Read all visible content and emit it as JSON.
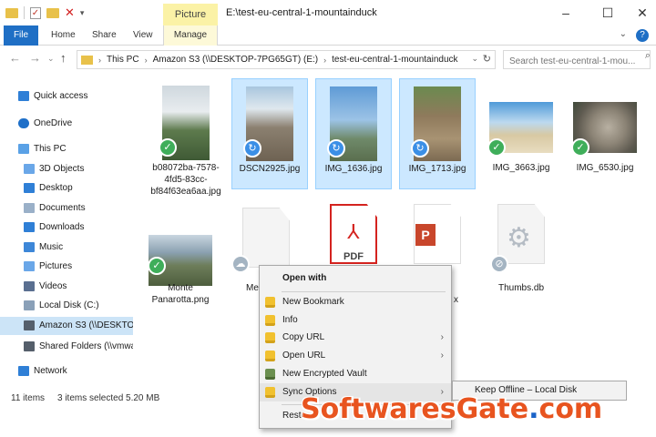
{
  "window": {
    "title": "E:\\test-eu-central-1-mountainduck",
    "context_tab_title": "Picture Tools",
    "controls": [
      "–",
      "☐",
      "✕"
    ]
  },
  "ribbon": {
    "tabs": [
      "File",
      "Home",
      "Share",
      "View"
    ],
    "context_tab": "Manage"
  },
  "address": {
    "crumbs": [
      "This PC",
      "Amazon S3 (\\\\DESKTOP-7PG65GT) (E:)",
      "test-eu-central-1-mountainduck"
    ],
    "search_placeholder": "Search test-eu-central-1-mou..."
  },
  "nav": {
    "items": [
      {
        "label": "Quick access",
        "icon": "star-icon",
        "color": "#2f7fd6"
      },
      {
        "label": "OneDrive",
        "icon": "cloud-icon",
        "color": "#1e6fc8"
      },
      {
        "label": "This PC",
        "icon": "computer-icon",
        "color": "#5aa1e6"
      },
      {
        "label": "3D Objects",
        "icon": "cube-icon",
        "color": "#6aa7e8"
      },
      {
        "label": "Desktop",
        "icon": "desktop-icon",
        "color": "#2f7fd6"
      },
      {
        "label": "Documents",
        "icon": "documents-icon",
        "color": "#9ab0c8"
      },
      {
        "label": "Downloads",
        "icon": "download-icon",
        "color": "#2f7fd6"
      },
      {
        "label": "Music",
        "icon": "music-icon",
        "color": "#3d87d8"
      },
      {
        "label": "Pictures",
        "icon": "pictures-icon",
        "color": "#6aa7e8"
      },
      {
        "label": "Videos",
        "icon": "videos-icon",
        "color": "#5a6f90"
      },
      {
        "label": "Local Disk (C:)",
        "icon": "drive-icon",
        "color": "#8aa0b8"
      },
      {
        "label": "Amazon S3 (\\\\DESKTOP-7",
        "icon": "network-drive-icon",
        "color": "#555f6b"
      },
      {
        "label": "Shared Folders (\\\\vmware",
        "icon": "network-drive-icon",
        "color": "#555f6b"
      },
      {
        "label": "Network",
        "icon": "network-icon",
        "color": "#2f7fd6"
      }
    ]
  },
  "files": [
    {
      "label": "b08072ba-7578-4fd5-83cc-bf84f63ea6aa.jpg",
      "badge": "ok",
      "selected": false
    },
    {
      "label": "DSCN2925.jpg",
      "badge": "sync",
      "selected": true
    },
    {
      "label": "IMG_1636.jpg",
      "badge": "sync",
      "selected": true
    },
    {
      "label": "IMG_1713.jpg",
      "badge": "sync",
      "selected": true
    },
    {
      "label": "IMG_3663.jpg",
      "badge": "ok",
      "selected": false
    },
    {
      "label": "IMG_6530.jpg",
      "badge": "ok",
      "selected": false
    },
    {
      "label": "Monte Panarotta.png",
      "badge": "ok",
      "selected": false
    },
    {
      "label": "Me",
      "badge": "cloud",
      "selected": false
    },
    {
      "label": "PDF",
      "badge": "ok",
      "selected": false
    },
    {
      "label": "x",
      "badge": "ok",
      "selected": false
    },
    {
      "label": "Thumbs.db",
      "badge": "off",
      "selected": false
    }
  ],
  "status": {
    "count": "11 items",
    "selection": "3 items selected  5.20 MB"
  },
  "context_menu": {
    "header": "Open with",
    "items": [
      {
        "label": "New Bookmark",
        "submenu": false
      },
      {
        "label": "Info",
        "submenu": false
      },
      {
        "label": "Copy URL",
        "submenu": true
      },
      {
        "label": "Open URL",
        "submenu": true
      },
      {
        "label": "New Encrypted Vault",
        "submenu": false
      },
      {
        "label": "Sync Options",
        "submenu": true
      },
      {
        "label": "Resto",
        "submenu": false
      }
    ],
    "submenu_item": "Keep Offline – Local Disk"
  },
  "watermark": {
    "text": "SoftwaresGate",
    "dot": ".",
    "tld": "com"
  }
}
